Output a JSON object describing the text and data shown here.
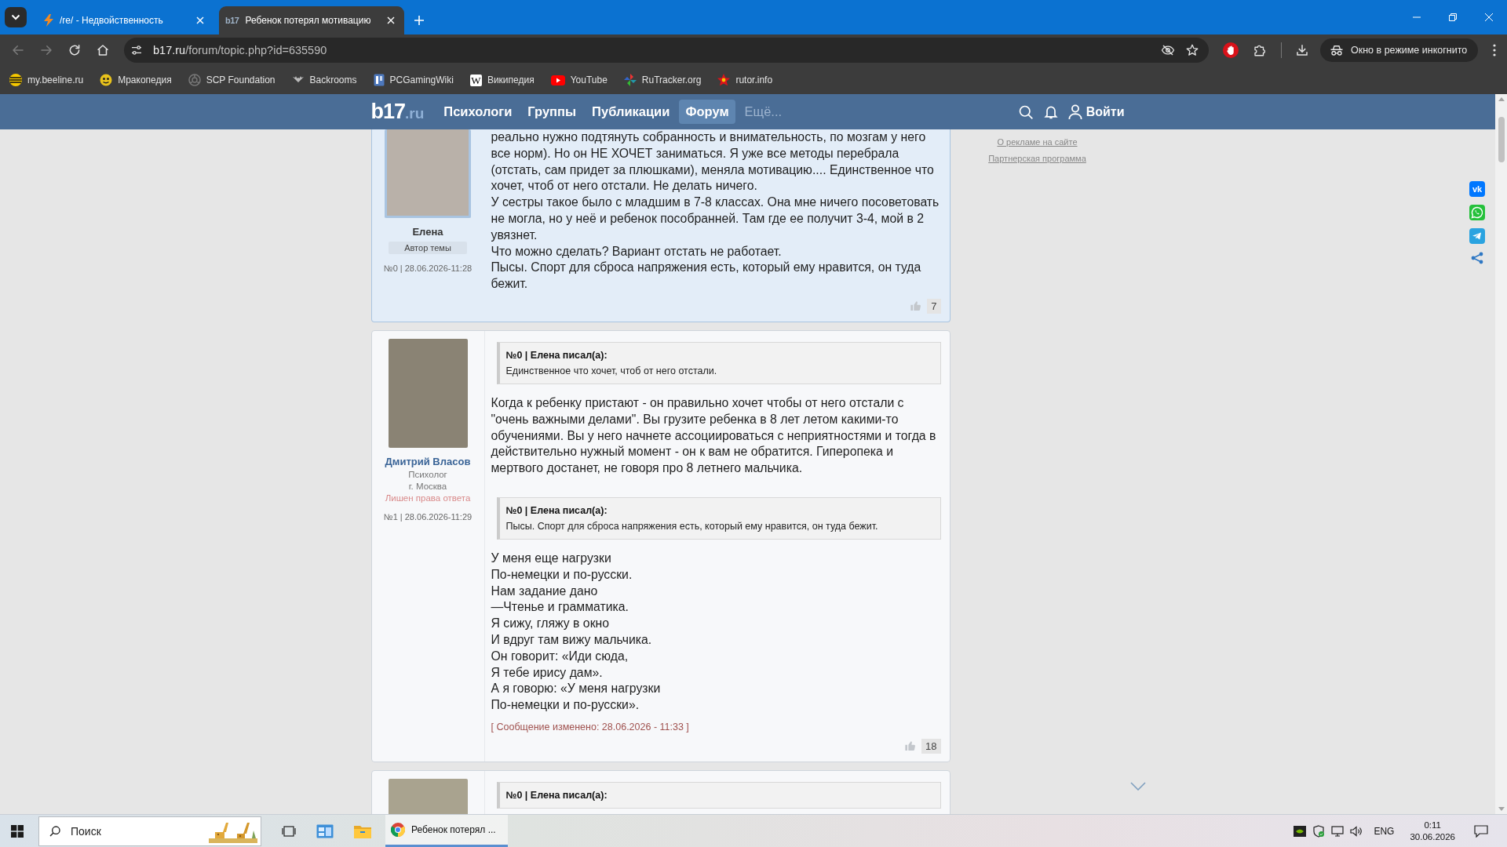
{
  "browser": {
    "tabs": [
      {
        "title": "/re/ - Недвойственность",
        "selected": false
      },
      {
        "favicon_text": "b17",
        "title": "Ребенок потерял мотивацию",
        "selected": true
      }
    ],
    "nav_buttons": [
      {
        "kind": "back",
        "disabled": true
      },
      {
        "kind": "forward",
        "disabled": true
      },
      {
        "kind": "reload",
        "disabled": false
      },
      {
        "kind": "home",
        "disabled": false
      }
    ],
    "address": {
      "host": "b17.ru",
      "path": "/forum/topic.php?id=635590"
    },
    "incognito_label": "Окно в режиме инкогнито",
    "bookmarks": [
      {
        "label": "my.beeline.ru"
      },
      {
        "label": "Мракопедия"
      },
      {
        "label": "SCP Foundation"
      },
      {
        "label": "Backrooms"
      },
      {
        "label": "PCGamingWiki"
      },
      {
        "label": "Википедия",
        "glyph": "W"
      },
      {
        "label": "YouTube"
      },
      {
        "label": "RuTracker.org"
      },
      {
        "label": "rutor.info"
      }
    ]
  },
  "site": {
    "logo": {
      "main": "b17",
      "suffix": ".ru"
    },
    "nav": [
      {
        "label": "Психологи",
        "kind": "link",
        "selected": false
      },
      {
        "label": "Группы",
        "kind": "link",
        "selected": false
      },
      {
        "label": "Публикации",
        "kind": "link",
        "selected": false
      },
      {
        "label": "Форум",
        "kind": "link",
        "selected": true
      },
      {
        "label": "Ещё...",
        "kind": "more",
        "selected": false
      }
    ],
    "login_label": "Войти",
    "sidebar_links": [
      "О рекламе на сайте",
      "Партнерская программа"
    ],
    "share_buttons": [
      {
        "kind": "vk",
        "glyph": "vk"
      },
      {
        "kind": "whatsapp"
      },
      {
        "kind": "telegram"
      },
      {
        "kind": "share"
      }
    ]
  },
  "posts": [
    {
      "highlighted": true,
      "author": {
        "kind": "user",
        "name": "Елена",
        "badge": "Автор темы"
      },
      "meta": "№0 | 28.06.2026-11:28",
      "blocks": [
        {
          "kind": "text",
          "lines": [
            "реально нужно подтянуть собранность и внимательность, по мозгам у него все норм). Но он НЕ ХОЧЕТ заниматься. Я уже все методы перебрала (отстать, сам придет за плюшками), меняла мотивацию.... Единственное что хочет, чтоб от него отстали. Не делать ничего.",
            "У сестры такое было с младшим в 7-8 классах. Она мне ничего посоветовать не могла, но у неё и ребенок пособранней. Там где ее получит 3-4, мой в 2 увязнет.",
            "Что можно сделать? Вариант отстать не работает.",
            "Пысы. Спорт для сброса напряжения есть, который ему нравится, он туда бежит."
          ]
        }
      ],
      "likes": "7"
    },
    {
      "highlighted": false,
      "author": {
        "kind": "psychologist",
        "name": "Дмитрий Власов",
        "role": "Психолог",
        "city": "г. Москва",
        "restriction": "Лишен права ответа"
      },
      "meta": "№1 | 28.06.2026-11:29",
      "blocks": [
        {
          "kind": "quote",
          "header": "№0 | Елена писал(а):",
          "text": "Единственное что хочет, чтоб от него отстали."
        },
        {
          "kind": "text",
          "lines": [
            "Когда к ребенку пристают - он правильно хочет чтобы от него отстали с \"очень важными делами\". Вы грузите ребенка в 8 лет летом какими-то обучениями. Вы у него начнете ассоциироваться с неприятностями и тогда в действительно нужный момент - он к вам не обратится. Гиперопека и мертвого достанет, не говоря про 8 летнего мальчика."
          ]
        },
        {
          "kind": "quote",
          "header": "№0 | Елена писал(а):",
          "text": "Пысы. Спорт для сброса напряжения есть, который ему нравится, он туда бежит."
        },
        {
          "kind": "text",
          "lines": [
            "У меня еще нагрузки",
            "По-немецки и по-русски.",
            "Нам задание дано",
            "—Чтенье и грамматика.",
            "Я сижу, гляжу в окно",
            "И вдруг там вижу мальчика.",
            "Он говорит: «Иди сюда,",
            "Я тебе ирису дам».",
            "А я говорю: «У меня нагрузки",
            "По-немецки и по-русски»."
          ]
        }
      ],
      "edit_note": "[ Сообщение изменено: 28.06.2026 - 11:33 ]",
      "likes": "18"
    },
    {
      "highlighted": false,
      "blocks": [
        {
          "kind": "quote",
          "header": "№0 | Елена писал(а):"
        }
      ]
    }
  ],
  "taskbar": {
    "search": {
      "placeholder": "Поиск"
    },
    "window_title": "Ребенок потерял ...",
    "language": "ENG",
    "time": "0:11",
    "date": "30.06.2026"
  }
}
